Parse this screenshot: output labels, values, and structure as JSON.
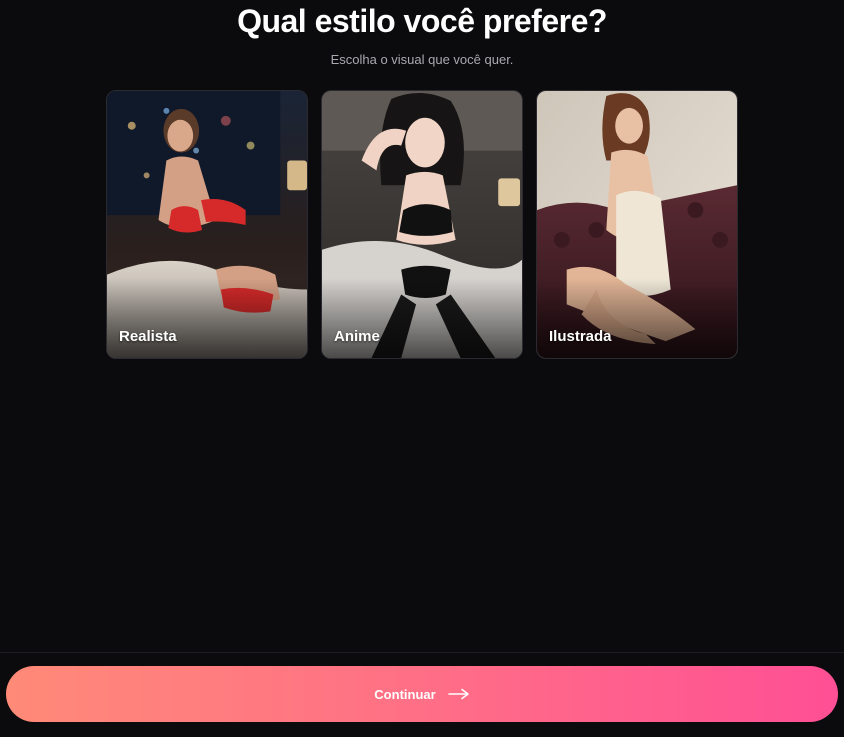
{
  "header": {
    "title": "Qual estilo você prefere?",
    "subtitle": "Escolha o visual que você quer."
  },
  "styles": [
    {
      "label": "Realista",
      "icon": "photo-realistic"
    },
    {
      "label": "Anime",
      "icon": "photo-anime"
    },
    {
      "label": "Ilustrada",
      "icon": "photo-illustrated"
    }
  ],
  "footer": {
    "continue_label": "Continuar",
    "continue_icon": "arrow-right-icon"
  },
  "colors": {
    "background": "#0b0b0d",
    "button_gradient_start": "#ff8a78",
    "button_gradient_end": "#ff4f95",
    "subtitle": "#a9a9b0"
  }
}
